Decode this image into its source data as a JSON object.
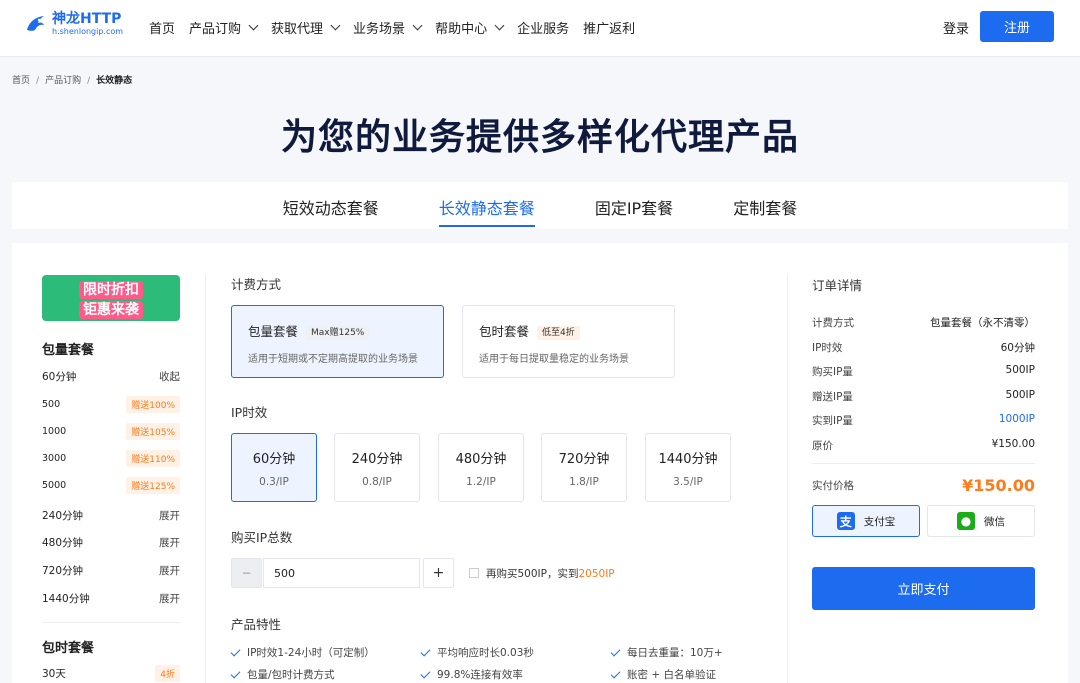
{
  "nav": {
    "brand_name": "神龙HTTP",
    "brand_domain": "h.shenlongip.com",
    "menu": [
      {
        "label": "首页",
        "dropdown": false
      },
      {
        "label": "产品订购",
        "dropdown": true
      },
      {
        "label": "获取代理",
        "dropdown": true
      },
      {
        "label": "业务场景",
        "dropdown": true
      },
      {
        "label": "帮助中心",
        "dropdown": true
      },
      {
        "label": "企业服务",
        "dropdown": false
      },
      {
        "label": "推广返利",
        "dropdown": false
      }
    ],
    "login": "登录",
    "register": "注册"
  },
  "breadcrumb": {
    "items": [
      "首页",
      "产品订购",
      "长效静态"
    ]
  },
  "hero_title": "为您的业务提供多样化代理产品",
  "tabs": [
    "短效动态套餐",
    "长效静态套餐",
    "固定IP套餐",
    "定制套餐"
  ],
  "active_tab": 1,
  "sidebar": {
    "promo_line1": "限时折扣",
    "promo_line2": "钜惠来袭",
    "section1_title": "包量套餐",
    "groups": [
      {
        "label": "60分钟",
        "action": "收起"
      },
      {
        "label": "240分钟",
        "action": "展开"
      },
      {
        "label": "480分钟",
        "action": "展开"
      },
      {
        "label": "720分钟",
        "action": "展开"
      },
      {
        "label": "1440分钟",
        "action": "展开"
      }
    ],
    "sub_items": [
      {
        "qty": "500",
        "bonus": "赠送100%"
      },
      {
        "qty": "1000",
        "bonus": "赠送105%"
      },
      {
        "qty": "3000",
        "bonus": "赠送110%"
      },
      {
        "qty": "5000",
        "bonus": "赠送125%"
      }
    ],
    "section2_title": "包时套餐",
    "time_item": {
      "label": "30天",
      "tag": "4折"
    }
  },
  "main": {
    "billing_label": "计费方式",
    "billing_options": [
      {
        "title": "包量套餐",
        "badge": "Max赠125%",
        "desc": "适用于短期或不定期高提取的业务场景"
      },
      {
        "title": "包时套餐",
        "badge": "低至4折",
        "desc": "适用于每日提取量稳定的业务场景"
      }
    ],
    "ip_validity_label": "IP时效",
    "validity_options": [
      {
        "duration": "60分钟",
        "price": "0.3/IP"
      },
      {
        "duration": "240分钟",
        "price": "0.8/IP"
      },
      {
        "duration": "480分钟",
        "price": "1.2/IP"
      },
      {
        "duration": "720分钟",
        "price": "1.8/IP"
      },
      {
        "duration": "1440分钟",
        "price": "3.5/IP"
      }
    ],
    "total_label": "购买IP总数",
    "minus": "−",
    "plus": "+",
    "quantity": "500",
    "upsell_text": "再购买500IP，实到",
    "upsell_highlight": "2050IP",
    "features_label": "产品特性",
    "features": [
      "IP时效1-24小时（可定制）",
      "平均响应时长0.03秒",
      "每日去重量：10万+",
      "包量/包时计费方式",
      "99.8%连接有效率",
      "账密 + 白名单验证"
    ]
  },
  "order": {
    "title": "订单详情",
    "rows": [
      {
        "label": "计费方式",
        "value": "包量套餐（永不清零）"
      },
      {
        "label": "IP时效",
        "value": "60分钟"
      },
      {
        "label": "购买IP量",
        "value": "500IP"
      },
      {
        "label": "赠送IP量",
        "value": "500IP"
      },
      {
        "label": "实到IP量",
        "value": "1000IP"
      },
      {
        "label": "原价",
        "value": "¥150.00"
      }
    ],
    "final_label": "实付价格",
    "final_price": "¥150.00",
    "pay_methods": [
      {
        "label": "支付宝",
        "icon": "alipay-icon",
        "color": "#1d6cf0"
      },
      {
        "label": "微信",
        "icon": "wechat-icon",
        "color": "#1aad19"
      }
    ],
    "pay_button": "立即支付"
  },
  "colors": {
    "primary": "#1d6cf0",
    "accent": "#ff7a1a",
    "heading": "#0f1a3c"
  }
}
